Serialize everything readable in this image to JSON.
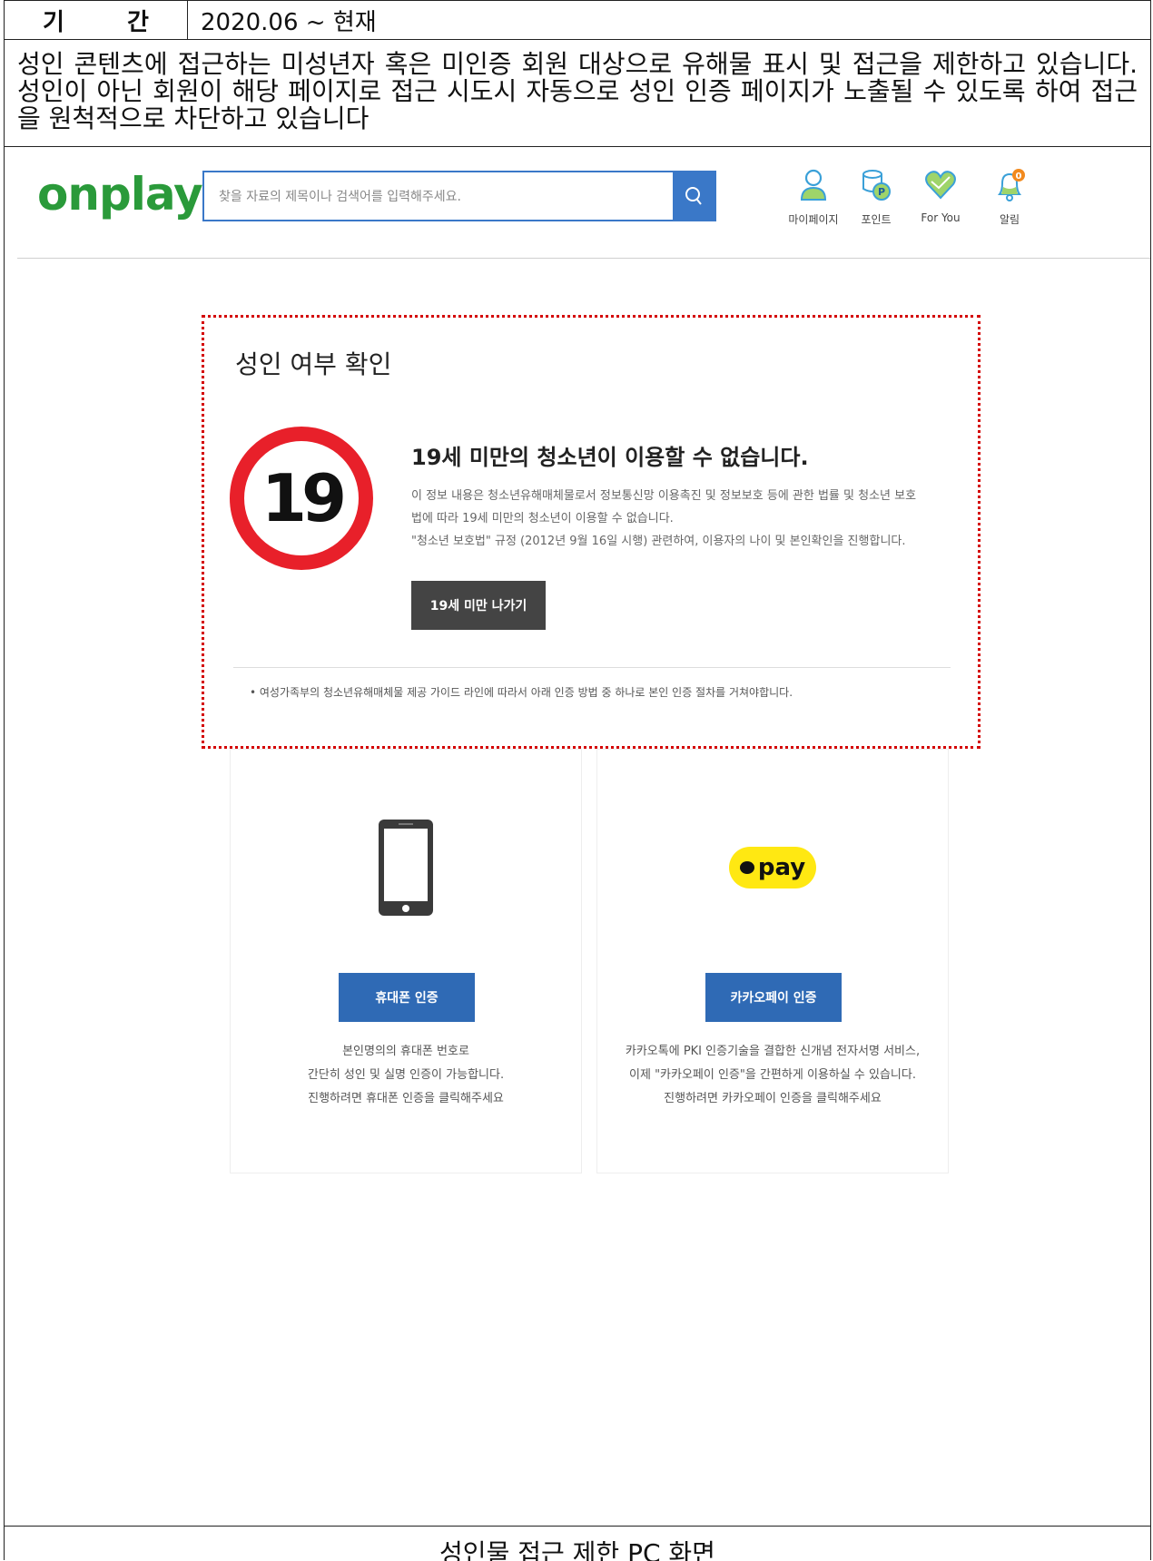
{
  "table": {
    "period_label": "기 간",
    "period_value": "2020.06 ~ 현재",
    "description": "성인 콘텐츠에 접근하는 미성년자 혹은 미인증 회원 대상으로 유해물 표시 및 접근을 제한하고 있습니다. 성인이 아닌 회원이 해당 페이지로 접근 시도시 자동으로 성인 인증 페이지가 노출될 수 있도록 하여 접근 을 원척적으로 차단하고 있습니다",
    "caption": "성인물 접근 제한 PC 화면"
  },
  "header": {
    "logo": "onplay",
    "search_placeholder": "찾을 자료의 제목이나 검색어를 입력해주세요.",
    "nav": [
      {
        "label": "마이페이지",
        "icon": "user-icon"
      },
      {
        "label": "포인트",
        "icon": "point-coin-icon"
      },
      {
        "label": "For You",
        "icon": "heart-icon"
      },
      {
        "label": "알림",
        "icon": "bell-icon"
      }
    ]
  },
  "verify": {
    "title": "성인 여부 확인",
    "age_sign": "19",
    "headline": "19세 미만의 청소년이 이용할 수 없습니다.",
    "body_line1": "이 정보 내용은 청소년유해매체물로서 정보통신망 이용촉진 및 정보보호 등에 관한 법률 및 청소년 보호",
    "body_line2": "법에 따라 19세 미만의 청소년이 이용할 수 없습니다.",
    "body_line3": "\"청소년 보호법\" 규정 (2012년 9월 16일 시행) 관련하여, 이용자의 나이 및 본인확인을 진행합니다.",
    "exit_button": "19세 미만 나가기",
    "note": "• 여성가족부의 청소년유해매체물 제공 가이드 라인에 따라서 아래 인증 방법 중 하나로 본인 인증 절차를 거쳐야합니다."
  },
  "methods": [
    {
      "button": "휴대폰 인증",
      "icon": "smartphone-icon",
      "desc": [
        "본인명의의 휴대폰 번호로",
        "간단히 성인 및 실명 인증이 가능합니다.",
        "진행하려면 휴대폰 인증을 클릭해주세요"
      ]
    },
    {
      "button": "카카오페이 인증",
      "icon": "kakaopay-logo",
      "logo_text": "pay",
      "desc": [
        "카카오톡에 PKI 인증기술을 결합한 신개념 전자서명 서비스,",
        "이제 \"카카오페이 인증\"을 간편하게 이용하실 수 있습니다.",
        "진행하려면 카카오페이 인증을 클릭해주세요"
      ]
    }
  ],
  "colors": {
    "accent_blue": "#3a78c8",
    "button_blue": "#2f6ab5",
    "logo_green": "#2a9a3a",
    "warning_red": "#e8202a",
    "kakao_yellow": "#ffe812"
  }
}
